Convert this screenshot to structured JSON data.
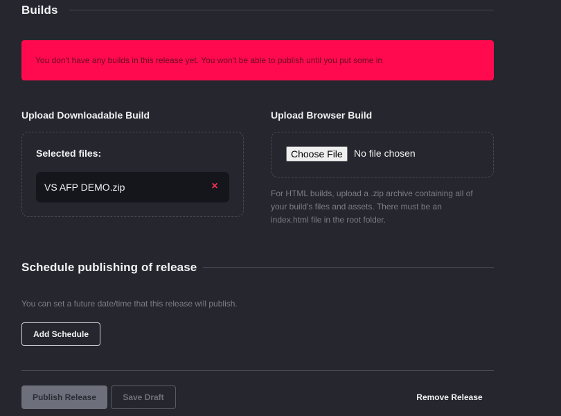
{
  "builds": {
    "heading": "Builds",
    "alert": "You don't have any builds in this release yet. You won't be able to publish until you put some in"
  },
  "downloadable": {
    "heading": "Upload Downloadable Build",
    "selected_label": "Selected files:",
    "files": [
      {
        "name": "VS AFP DEMO.zip",
        "remove_icon": "×"
      }
    ]
  },
  "browser": {
    "heading": "Upload Browser Build",
    "choose_label": "Choose File",
    "no_file_text": "No file chosen",
    "help_lines": [
      "For HTML builds, upload a .zip archive containing all of",
      "your build's files and assets. There must be an",
      "index.html file in the root folder."
    ]
  },
  "schedule": {
    "heading": "Schedule publishing of release",
    "description": "You can set a future date/time that this release will publish.",
    "add_label": "Add Schedule"
  },
  "actions": {
    "publish_label": "Publish Release",
    "draft_label": "Save Draft",
    "remove_label": "Remove Release"
  },
  "colors": {
    "background": "#25262e",
    "alert": "#ff0a4e",
    "remove_icon": "#ff2d55"
  }
}
